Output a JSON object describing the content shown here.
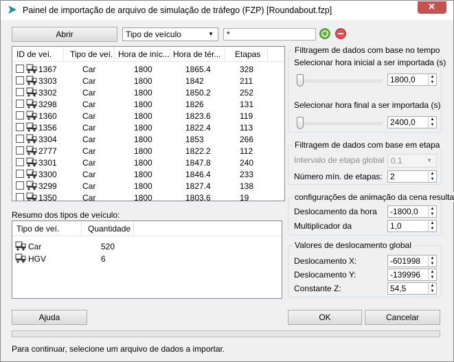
{
  "window": {
    "title": "Painel de importação de arquivo de simulação de tráfego (FZP) [Roundabout.fzp]",
    "close_glyph": "✕"
  },
  "toolbar": {
    "open_label": "Abrir",
    "vehicle_type_selected": "Tipo de veículo",
    "filter_value": "*"
  },
  "vehicle_table": {
    "headers": [
      "ID de veí.",
      "Tipo de veí.",
      "Hora de iníc...",
      "Hora de tér...",
      "Etapas"
    ],
    "rows": [
      {
        "id": "1367",
        "type": "Car",
        "start": "1800",
        "end": "1865.4",
        "steps": "328"
      },
      {
        "id": "3303",
        "type": "Car",
        "start": "1800",
        "end": "1842",
        "steps": "211"
      },
      {
        "id": "3302",
        "type": "Car",
        "start": "1800",
        "end": "1850.2",
        "steps": "252"
      },
      {
        "id": "3298",
        "type": "Car",
        "start": "1800",
        "end": "1826",
        "steps": "131"
      },
      {
        "id": "1360",
        "type": "Car",
        "start": "1800",
        "end": "1823.6",
        "steps": "119"
      },
      {
        "id": "1356",
        "type": "Car",
        "start": "1800",
        "end": "1822.4",
        "steps": "113"
      },
      {
        "id": "3304",
        "type": "Car",
        "start": "1800",
        "end": "1853",
        "steps": "266"
      },
      {
        "id": "2777",
        "type": "Car",
        "start": "1800",
        "end": "1822.2",
        "steps": "112"
      },
      {
        "id": "3301",
        "type": "Car",
        "start": "1800",
        "end": "1847.8",
        "steps": "240"
      },
      {
        "id": "3300",
        "type": "Car",
        "start": "1800",
        "end": "1846.4",
        "steps": "233"
      },
      {
        "id": "3299",
        "type": "Car",
        "start": "1800",
        "end": "1827.4",
        "steps": "138"
      },
      {
        "id": "1350",
        "type": "Car",
        "start": "1800",
        "end": "1803.6",
        "steps": "19"
      }
    ]
  },
  "summary": {
    "label": "Resumo dos tipos de veículo:",
    "headers": [
      "Tipo de veí.",
      "Quantidade"
    ],
    "rows": [
      {
        "type": "Car",
        "count": "520"
      },
      {
        "type": "HGV",
        "count": "6"
      }
    ]
  },
  "time_filter": {
    "title": "Filtragem de dados com base no tempo",
    "start_label": "Selecionar hora inicial a ser importada (s)",
    "start_value": "1800,0",
    "end_label": "Selecionar hora final a ser importada (s)",
    "end_value": "2400,0",
    "start_slider_fraction": 0,
    "end_slider_fraction": 0
  },
  "step_filter": {
    "title": "Filtragem de dados com base em etapa",
    "interval_label": "Intervalo de etapa global",
    "interval_value": "0.1",
    "min_steps_label": "Número mín. de etapas:",
    "min_steps_value": "2"
  },
  "animation": {
    "title": "configurações de animação da cena resulta",
    "offset_label": "Deslocamento da hora",
    "offset_value": "-1800,0",
    "multiplier_label": "Multiplicador da",
    "multiplier_value": "1,0"
  },
  "global_offset": {
    "title": "Valores de deslocamento global",
    "x_label": "Deslocamento X:",
    "x_value": "-601998",
    "y_label": "Deslocamento Y:",
    "y_value": "-139996",
    "z_label": "Constante Z:",
    "z_value": "54,5"
  },
  "footer": {
    "help_label": "Ajuda",
    "ok_label": "OK",
    "cancel_label": "Cancelar",
    "status": "Para continuar, selecione um arquivo de dados a importar.",
    "progress_fraction": 0
  }
}
